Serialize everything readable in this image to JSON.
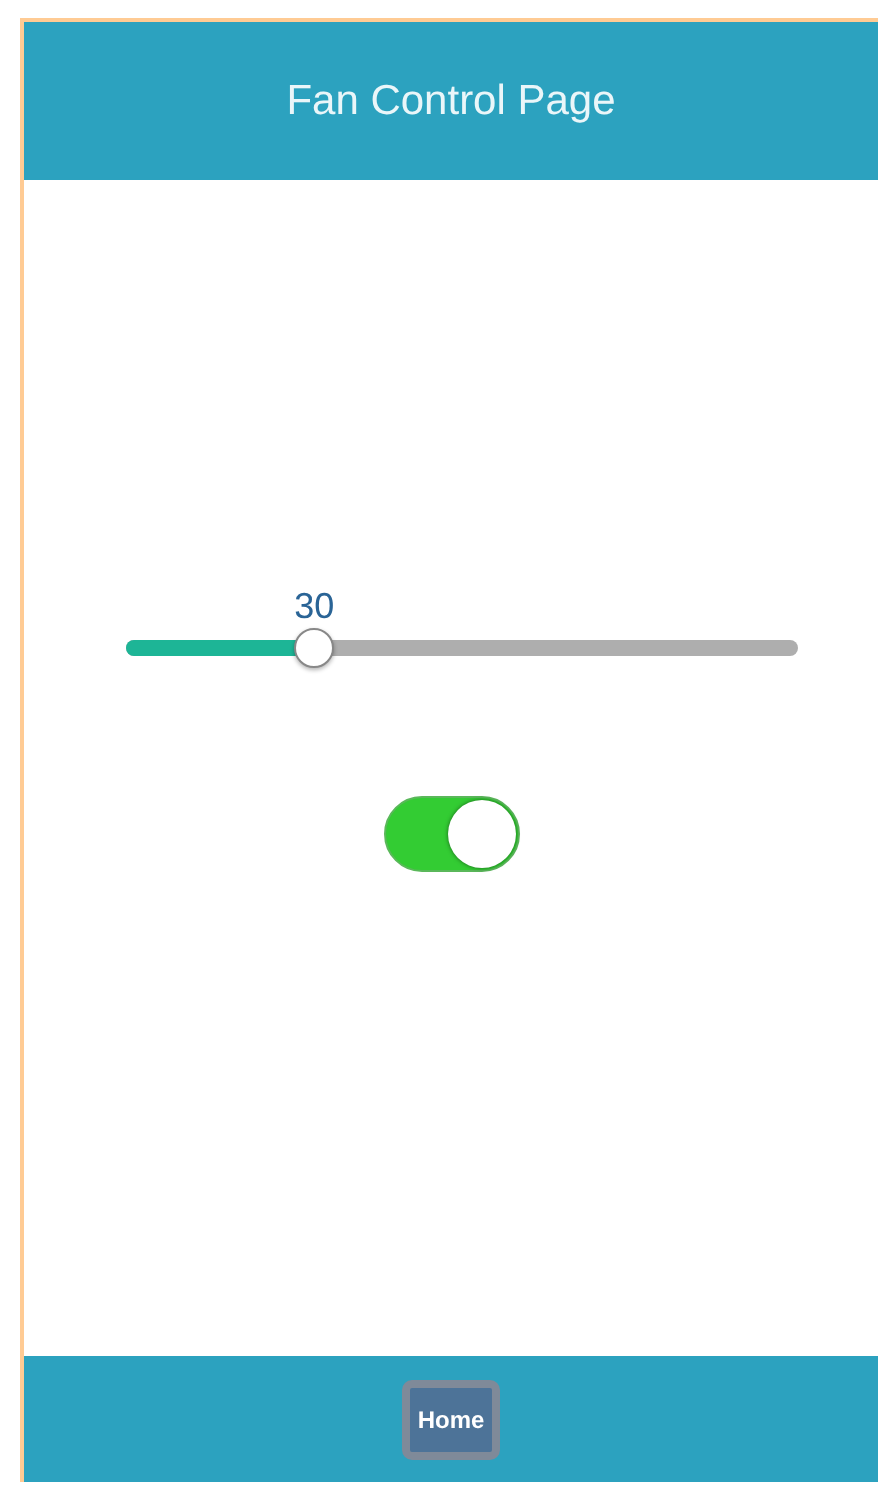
{
  "header": {
    "title": "Fan Control Page"
  },
  "slider": {
    "value": "30",
    "level": 0.28
  },
  "toggle": {
    "on": true
  },
  "footer": {
    "buttons": [
      "Home"
    ]
  }
}
